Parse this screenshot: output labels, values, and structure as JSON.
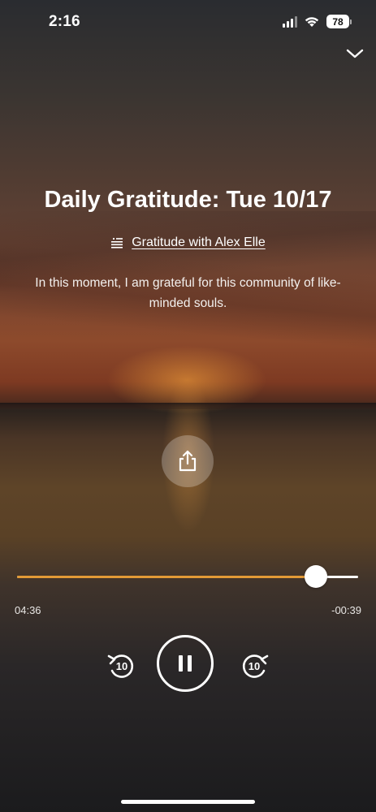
{
  "status_bar": {
    "time": "2:16",
    "battery": "78",
    "icons": [
      "cellular-signal-icon",
      "wifi-icon",
      "battery-icon"
    ]
  },
  "header": {
    "collapse_icon": "chevron-down-icon"
  },
  "track": {
    "title": "Daily Gratitude: Tue 10/17",
    "series_icon": "playlist-icon",
    "series_label": "Gratitude with Alex Elle",
    "description": "In this moment, I am grateful for this community of like-minded souls."
  },
  "share": {
    "icon": "share-icon"
  },
  "player": {
    "elapsed": "04:36",
    "remaining": "-00:39",
    "progress_fraction": 0.876,
    "progress_color": "#e39a36",
    "skip_back_seconds": "10",
    "skip_forward_seconds": "10",
    "state": "playing"
  }
}
